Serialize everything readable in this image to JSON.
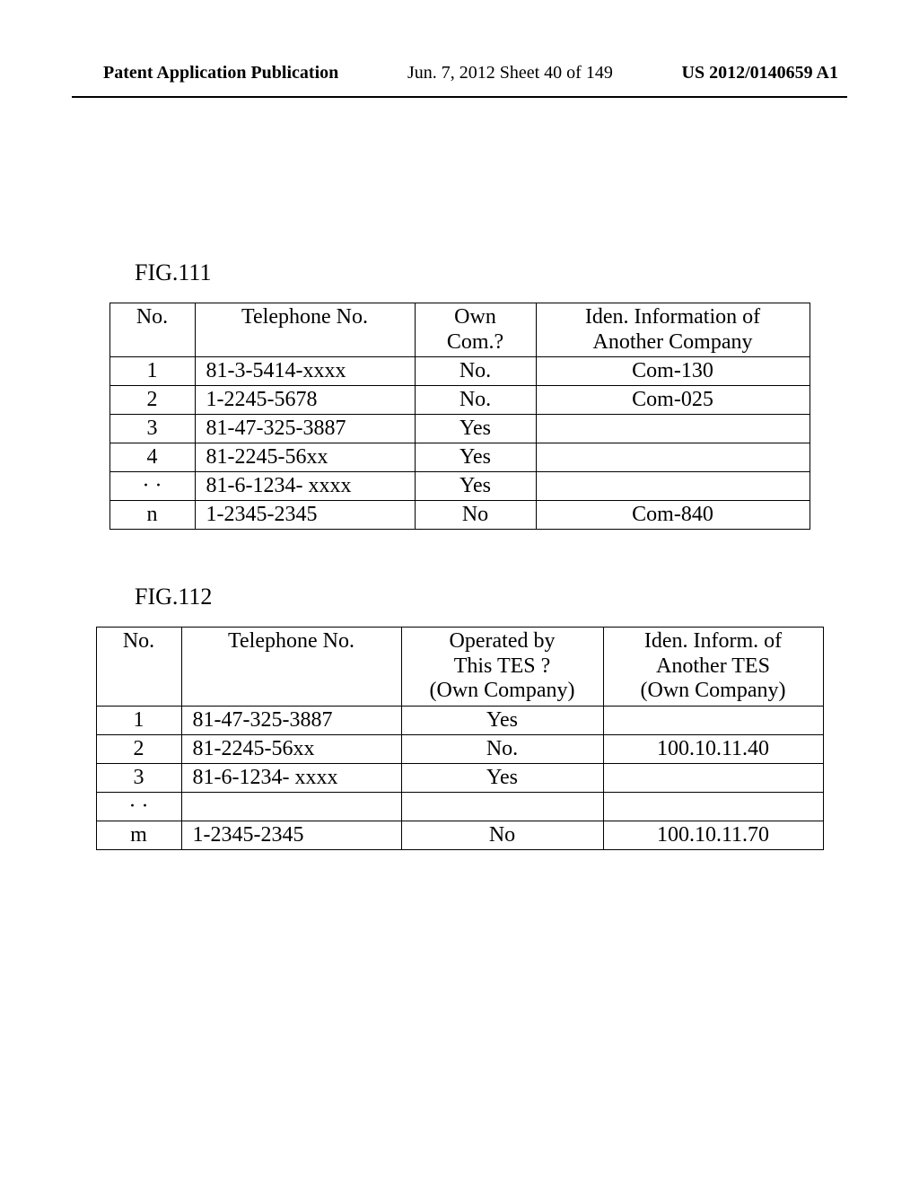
{
  "header": {
    "left": "Patent Application Publication",
    "center": "Jun. 7, 2012  Sheet 40 of 149",
    "right": "US 2012/0140659 A1"
  },
  "fig1": {
    "label": "FIG.111",
    "headers": {
      "no": "No.",
      "tel": "Telephone No.",
      "c3a": "Own",
      "c3b": "Com.?",
      "c4a": "Iden. Information of",
      "c4b": "Another Company"
    },
    "rows": [
      {
        "no": "1",
        "tel": "81-3-5414-xxxx",
        "c3": "No.",
        "c4": "Com-130"
      },
      {
        "no": "2",
        "tel": "1-2245-5678",
        "c3": "No.",
        "c4": "Com-025"
      },
      {
        "no": "3",
        "tel": "81-47-325-3887",
        "c3": "Yes",
        "c4": ""
      },
      {
        "no": "4",
        "tel": "81-2245-56xx",
        "c3": "Yes",
        "c4": ""
      },
      {
        "no": "· ·",
        "tel": "81-6-1234- xxxx",
        "c3": "Yes",
        "c4": ""
      },
      {
        "no": "n",
        "tel": "1-2345-2345",
        "c3": "No",
        "c4": "Com-840"
      }
    ]
  },
  "fig2": {
    "label": "FIG.112",
    "headers": {
      "no": "No.",
      "tel": "Telephone No.",
      "c3a": "Operated by",
      "c3b": "This TES ?",
      "c3c": "(Own Company)",
      "c4a": "Iden. Inform. of",
      "c4b": "Another TES",
      "c4c": "(Own Company)"
    },
    "rows": [
      {
        "no": "1",
        "tel": "81-47-325-3887",
        "c3": "Yes",
        "c4": ""
      },
      {
        "no": "2",
        "tel": "81-2245-56xx",
        "c3": "No.",
        "c4": "100.10.11.40"
      },
      {
        "no": "3",
        "tel": "81-6-1234- xxxx",
        "c3": "Yes",
        "c4": ""
      },
      {
        "no": "· ·",
        "tel": "",
        "c3": "",
        "c4": ""
      },
      {
        "no": "m",
        "tel": "1-2345-2345",
        "c3": "No",
        "c4": "100.10.11.70"
      }
    ]
  },
  "chart_data": [
    {
      "type": "table",
      "title": "FIG.111",
      "columns": [
        "No.",
        "Telephone No.",
        "Own Com.?",
        "Iden. Information of Another Company"
      ],
      "rows": [
        [
          "1",
          "81-3-5414-xxxx",
          "No.",
          "Com-130"
        ],
        [
          "2",
          "1-2245-5678",
          "No.",
          "Com-025"
        ],
        [
          "3",
          "81-47-325-3887",
          "Yes",
          ""
        ],
        [
          "4",
          "81-2245-56xx",
          "Yes",
          ""
        ],
        [
          "· ·",
          "81-6-1234- xxxx",
          "Yes",
          ""
        ],
        [
          "n",
          "1-2345-2345",
          "No",
          "Com-840"
        ]
      ]
    },
    {
      "type": "table",
      "title": "FIG.112",
      "columns": [
        "No.",
        "Telephone No.",
        "Operated by This TES ? (Own Company)",
        "Iden. Inform. of Another TES (Own Company)"
      ],
      "rows": [
        [
          "1",
          "81-47-325-3887",
          "Yes",
          ""
        ],
        [
          "2",
          "81-2245-56xx",
          "No.",
          "100.10.11.40"
        ],
        [
          "3",
          "81-6-1234- xxxx",
          "Yes",
          ""
        ],
        [
          "· ·",
          "",
          "",
          ""
        ],
        [
          "m",
          "1-2345-2345",
          "No",
          "100.10.11.70"
        ]
      ]
    }
  ]
}
